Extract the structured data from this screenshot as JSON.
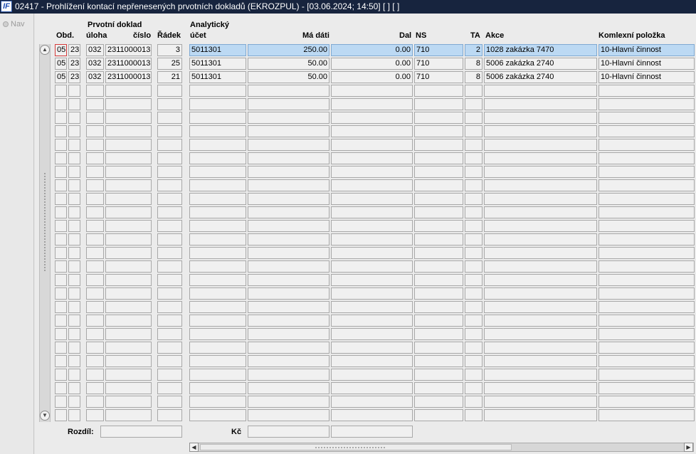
{
  "window": {
    "title": "02417 - Prohlížení kontací nepřenesených prvotních dokladů (EKROZPUL) - [03.06.2024; 14:50]  [ ]  [ ]",
    "icon_text": "IF"
  },
  "nav": {
    "label": "Nav"
  },
  "headers": {
    "obd": "Obd.",
    "prvotni_doklad": "Prvotní doklad",
    "uloha": "úloha",
    "cislo": "číslo",
    "radek": "Řádek",
    "analyticky": "Analytický",
    "ucet": "účet",
    "ma_dati": "Má dáti",
    "dal": "Dal",
    "ns": "NS",
    "ta": "TA",
    "akce": "Akce",
    "komlexni_polozka": "Komlexní položka"
  },
  "rows": [
    {
      "obd": "05",
      "year": "23",
      "uloha": "032",
      "cislo": "2311000013",
      "radek": "3",
      "ucet": "5011301",
      "ma_dati": "250.00",
      "dal": "0.00",
      "ns": "710",
      "ta": "2",
      "akce": "1028 zakázka 7470",
      "polozka": "10-Hlavní činnost",
      "selected": true
    },
    {
      "obd": "05",
      "year": "23",
      "uloha": "032",
      "cislo": "2311000013",
      "radek": "25",
      "ucet": "5011301",
      "ma_dati": "50.00",
      "dal": "0.00",
      "ns": "710",
      "ta": "8",
      "akce": "5006 zakázka 2740",
      "polozka": "10-Hlavní činnost",
      "selected": false
    },
    {
      "obd": "05",
      "year": "23",
      "uloha": "032",
      "cislo": "2311000013",
      "radek": "21",
      "ucet": "5011301",
      "ma_dati": "50.00",
      "dal": "0.00",
      "ns": "710",
      "ta": "8",
      "akce": "5006 zakázka 2740",
      "polozka": "10-Hlavní činnost",
      "selected": false
    }
  ],
  "total_rows": 28,
  "footer": {
    "rozdil_label": "Rozdíl:",
    "rozdil_value": "",
    "kc_label": "Kč",
    "kc_ma_dati": "",
    "kc_dal": ""
  },
  "scroll": {
    "up_icon": "scroll-up-icon",
    "down_icon": "scroll-down-icon",
    "left_icon": "scroll-left-icon",
    "right_icon": "scroll-right-icon"
  }
}
